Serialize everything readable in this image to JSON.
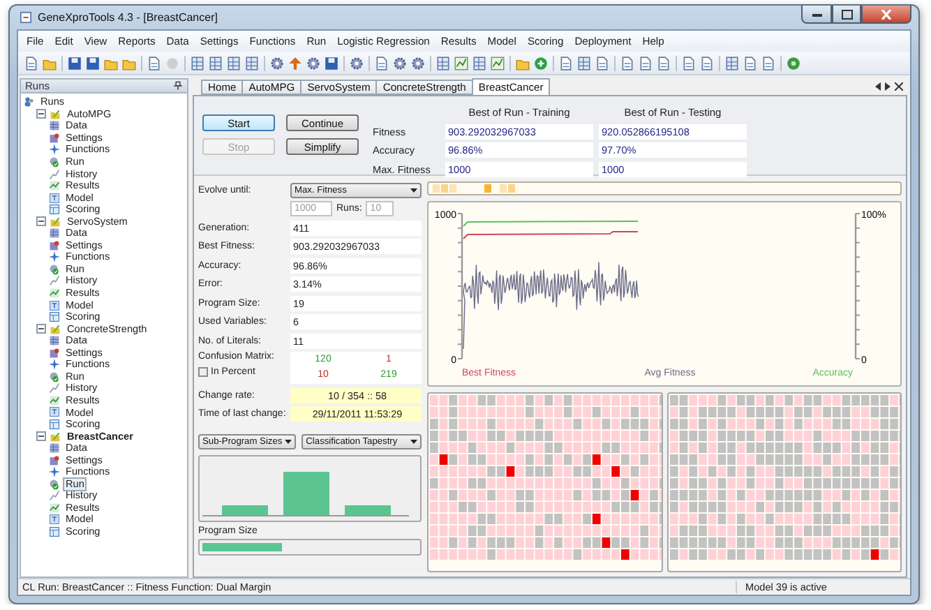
{
  "window": {
    "title": "GeneXproTools 4.3 - [BreastCancer]"
  },
  "menu": [
    "File",
    "Edit",
    "View",
    "Reports",
    "Data",
    "Settings",
    "Functions",
    "Run",
    "Logistic Regression",
    "Results",
    "Model",
    "Scoring",
    "Deployment",
    "Help"
  ],
  "sidebar": {
    "title": "Runs",
    "tree": [
      {
        "label": "Runs",
        "kind": "root",
        "children": [
          {
            "label": "AutoMPG",
            "kind": "project",
            "active": false,
            "expanded": true,
            "children": [
              {
                "label": "Data",
                "kind": "data",
                "selected": false
              },
              {
                "label": "Settings",
                "kind": "settings",
                "selected": false
              },
              {
                "label": "Functions",
                "kind": "functions",
                "selected": false
              },
              {
                "label": "Run",
                "kind": "run",
                "selected": false
              },
              {
                "label": "History",
                "kind": "history",
                "selected": false
              },
              {
                "label": "Results",
                "kind": "results",
                "selected": false
              },
              {
                "label": "Model",
                "kind": "model",
                "selected": false
              },
              {
                "label": "Scoring",
                "kind": "scoring",
                "selected": false
              }
            ]
          },
          {
            "label": "ServoSystem",
            "kind": "project",
            "active": false,
            "expanded": true,
            "children": [
              {
                "label": "Data",
                "kind": "data",
                "selected": false
              },
              {
                "label": "Settings",
                "kind": "settings",
                "selected": false
              },
              {
                "label": "Functions",
                "kind": "functions",
                "selected": false
              },
              {
                "label": "Run",
                "kind": "run",
                "selected": false
              },
              {
                "label": "History",
                "kind": "history",
                "selected": false
              },
              {
                "label": "Results",
                "kind": "results",
                "selected": false
              },
              {
                "label": "Model",
                "kind": "model",
                "selected": false
              },
              {
                "label": "Scoring",
                "kind": "scoring",
                "selected": false
              }
            ]
          },
          {
            "label": "ConcreteStrength",
            "kind": "project",
            "active": false,
            "expanded": true,
            "children": [
              {
                "label": "Data",
                "kind": "data",
                "selected": false
              },
              {
                "label": "Settings",
                "kind": "settings",
                "selected": false
              },
              {
                "label": "Functions",
                "kind": "functions",
                "selected": false
              },
              {
                "label": "Run",
                "kind": "run",
                "selected": false
              },
              {
                "label": "History",
                "kind": "history",
                "selected": false
              },
              {
                "label": "Results",
                "kind": "results",
                "selected": false
              },
              {
                "label": "Model",
                "kind": "model",
                "selected": false
              },
              {
                "label": "Scoring",
                "kind": "scoring",
                "selected": false
              }
            ]
          },
          {
            "label": "BreastCancer",
            "kind": "project",
            "active": true,
            "expanded": true,
            "children": [
              {
                "label": "Data",
                "kind": "data",
                "selected": false
              },
              {
                "label": "Settings",
                "kind": "settings",
                "selected": false
              },
              {
                "label": "Functions",
                "kind": "functions",
                "selected": false
              },
              {
                "label": "Run",
                "kind": "run",
                "selected": true
              },
              {
                "label": "History",
                "kind": "history",
                "selected": false
              },
              {
                "label": "Results",
                "kind": "results",
                "selected": false
              },
              {
                "label": "Model",
                "kind": "model",
                "selected": false
              },
              {
                "label": "Scoring",
                "kind": "scoring",
                "selected": false
              }
            ]
          }
        ]
      }
    ]
  },
  "tabs": [
    {
      "label": "Home",
      "selected": false
    },
    {
      "label": "AutoMPG",
      "selected": false
    },
    {
      "label": "ServoSystem",
      "selected": false
    },
    {
      "label": "ConcreteStrength",
      "selected": false
    },
    {
      "label": "BreastCancer",
      "selected": true
    }
  ],
  "buttons": [
    {
      "label": "Start",
      "disabled": false,
      "focused": true
    },
    {
      "label": "Continue",
      "disabled": false,
      "focused": false
    },
    {
      "label": "Stop",
      "disabled": true,
      "focused": false
    },
    {
      "label": "Simplify",
      "disabled": false,
      "focused": false
    }
  ],
  "best_of_run": {
    "columns": [
      "Best of Run - Training",
      "Best of Run - Testing"
    ],
    "rows": [
      {
        "label": "Fitness",
        "values": [
          "903.292032967033",
          "920.052866195108"
        ]
      },
      {
        "label": "Accuracy",
        "values": [
          "96.86%",
          "97.70%"
        ]
      },
      {
        "label": "Max. Fitness",
        "values": [
          "1000",
          "1000"
        ]
      }
    ]
  },
  "evolve": {
    "label": "Evolve until:",
    "mode": "Max. Fitness",
    "target": {
      "value": "1000",
      "disabled": true
    },
    "runs_label": "Runs:",
    "runs": {
      "value": "10",
      "disabled": true
    }
  },
  "stats": [
    {
      "label": "Generation:",
      "value": "411"
    },
    {
      "label": "Best Fitness:",
      "value": "903.292032967033"
    },
    {
      "label": "Accuracy:",
      "value": "96.86%"
    },
    {
      "label": "Error:",
      "value": "3.14%"
    },
    {
      "label": "Program Size:",
      "value": "19"
    },
    {
      "label": "Used Variables:",
      "value": "6"
    },
    {
      "label": "No. of Literals:",
      "value": "11"
    }
  ],
  "confusion": {
    "label": "Confusion Matrix:",
    "cells": [
      {
        "value": "120",
        "correct": true
      },
      {
        "value": "1",
        "correct": false
      },
      {
        "value": "10",
        "correct": false
      },
      {
        "value": "219",
        "correct": true
      }
    ],
    "in_percent": {
      "label": "In Percent",
      "checked": false
    }
  },
  "change": [
    {
      "label": "Change rate:",
      "value": "10 / 354 :: 58"
    },
    {
      "label": "Time of last change:",
      "value": "29/11/2011 11:53:29"
    }
  ],
  "selectors": [
    "Sub-Program Sizes",
    "Classification Tapestry"
  ],
  "program_size": {
    "label": "Program Size",
    "level": 0.37
  },
  "chart": {
    "left_ticks": [
      "1000",
      "0"
    ],
    "right_ticks": [
      "100%",
      "0"
    ],
    "legend": [
      {
        "label": "Best Fitness",
        "color": "#d04858"
      },
      {
        "label": "Avg Fitness",
        "color": "#6a6a88"
      },
      {
        "label": "Accuracy",
        "color": "#5cc05c"
      }
    ]
  },
  "status_bar": {
    "left": "CL Run: BreastCancer :: Fitness Function: Dual Margin",
    "right": "Model 39 is active"
  }
}
